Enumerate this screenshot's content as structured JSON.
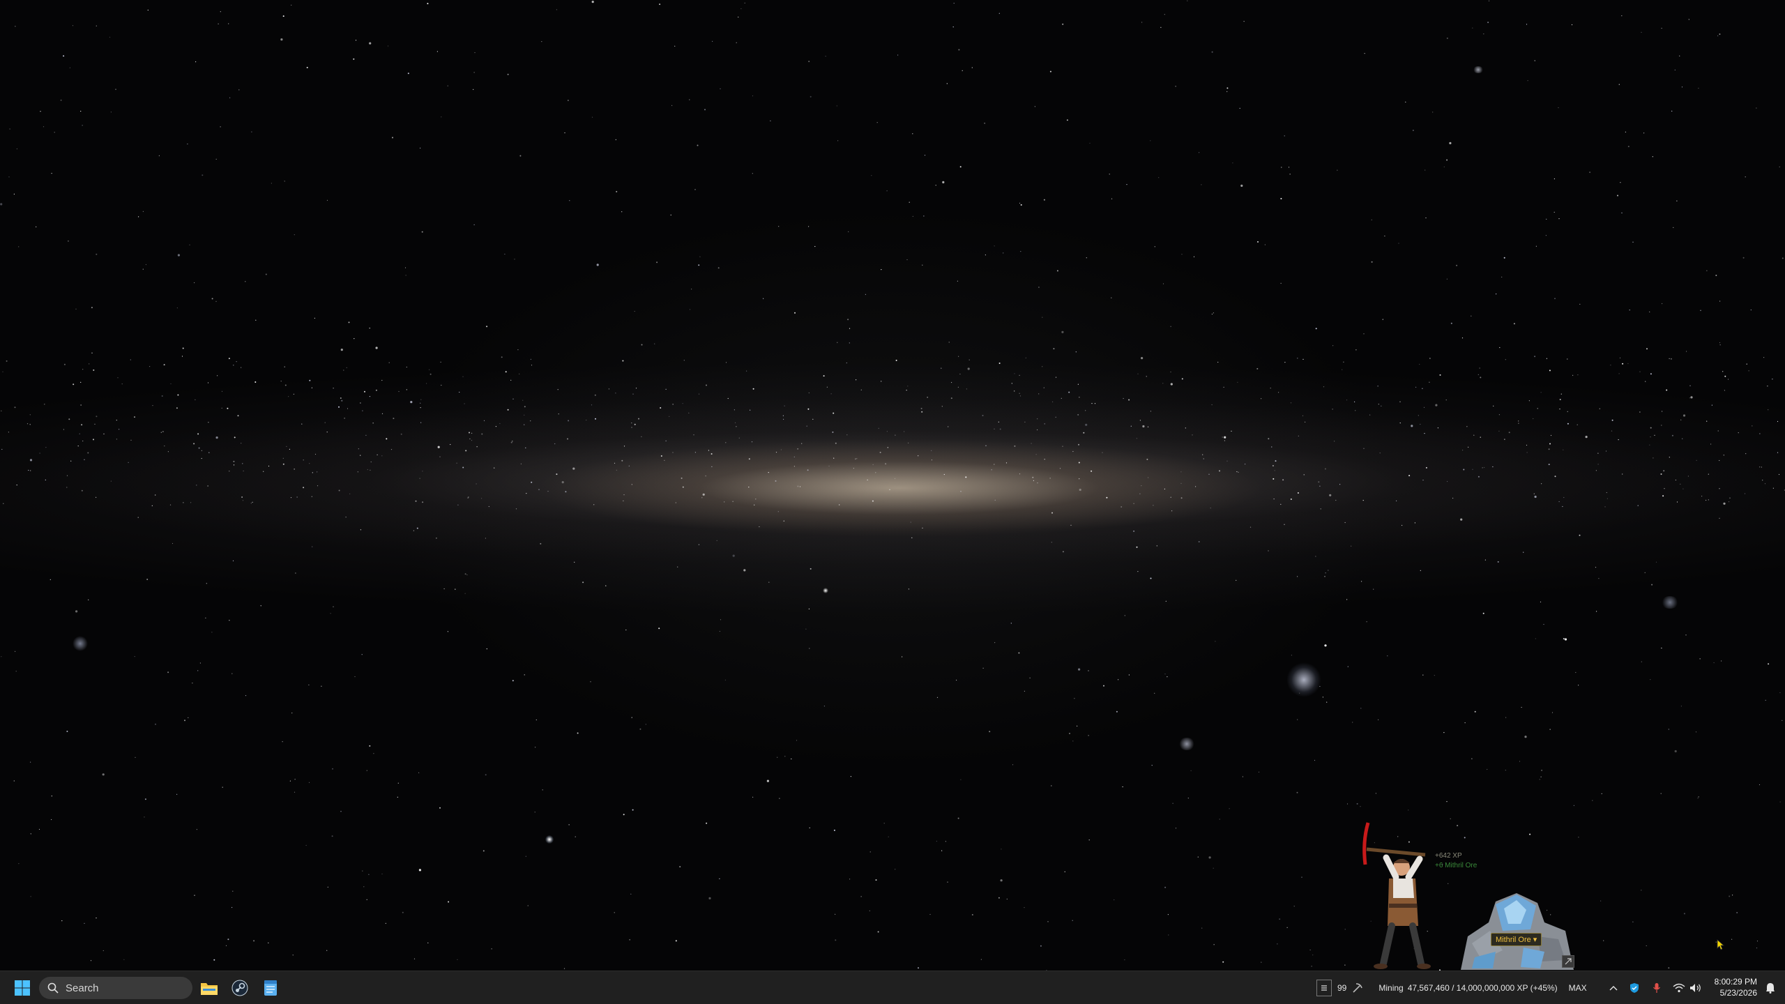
{
  "taskbar": {
    "search_label": "Search",
    "pinned": [
      {
        "name": "File Explorer",
        "icon": "folder-icon"
      },
      {
        "name": "Steam",
        "icon": "steam-icon"
      },
      {
        "name": "Notepad",
        "icon": "notepad-icon"
      }
    ],
    "accent": "#0078d4",
    "background": "#202020"
  },
  "game_widget": {
    "level": "99",
    "skill": "Mining",
    "xp_progress": "47,567,460 / 14,000,000,000 XP (+45%)",
    "max_label": "MAX",
    "xp_popup": "+642 XP",
    "ore_popup": "+6 Mithril Ore",
    "ore_selector": "Mithril Ore ▾"
  },
  "tray": {
    "icons": [
      "chevron-up-icon",
      "security-icon",
      "microphone-icon",
      "wifi-icon",
      "volume-icon",
      "notification-icon"
    ]
  },
  "clock": {
    "time": "8:00:29 PM",
    "date": "5/23/2026"
  },
  "wallpaper": {
    "description_colors": {
      "space": "#050506",
      "galaxy_core": "#e8d8bc"
    }
  }
}
